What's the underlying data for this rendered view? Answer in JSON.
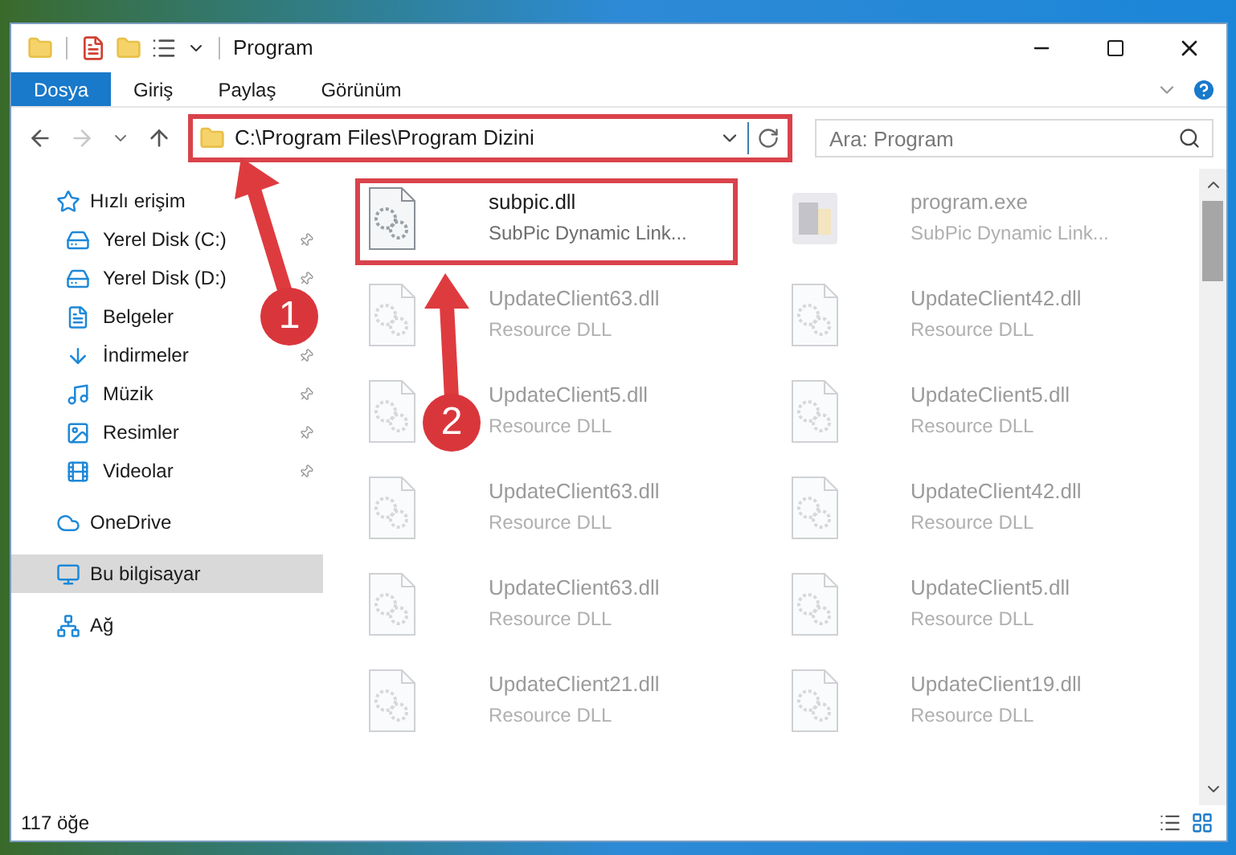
{
  "window": {
    "title": "Program"
  },
  "ribbon": {
    "tabs": [
      {
        "label": "Dosya",
        "kind": "file",
        "selected": false
      },
      {
        "label": "Giriş",
        "kind": "tab",
        "selected": false
      },
      {
        "label": "Paylaş",
        "kind": "tab",
        "selected": false
      },
      {
        "label": "Görünüm",
        "kind": "tab",
        "selected": false
      }
    ]
  },
  "address_bar": {
    "path": "C:\\Program Files\\Program Dizini",
    "highlighted": true
  },
  "search": {
    "placeholder": "Ara: Program"
  },
  "sidebar": {
    "items": [
      {
        "label": "Hızlı erişim",
        "selected": false,
        "children": [
          {
            "label": "Yerel Disk (C:)",
            "pinned": true
          },
          {
            "label": "Yerel Disk (D:)",
            "pinned": true
          },
          {
            "label": "Belgeler",
            "pinned": false
          },
          {
            "label": "İndirmeler",
            "pinned": true
          },
          {
            "label": "Müzik",
            "pinned": true
          },
          {
            "label": "Resimler",
            "pinned": true
          },
          {
            "label": "Videolar",
            "pinned": true
          }
        ]
      },
      {
        "label": "OneDrive",
        "selected": false
      },
      {
        "label": "Bu bilgisayar",
        "selected": true
      },
      {
        "label": "Ağ",
        "selected": false
      }
    ]
  },
  "files": [
    {
      "name": "subpic.dll",
      "type": "SubPic Dynamic Link...",
      "kind": "dll",
      "highlighted": true,
      "dimmed": false
    },
    {
      "name": "program.exe",
      "type": "SubPic Dynamic Link...",
      "kind": "exe",
      "highlighted": false,
      "dimmed": true
    },
    {
      "name": "UpdateClient63.dll",
      "type": "Resource DLL",
      "kind": "dll",
      "highlighted": false,
      "dimmed": true
    },
    {
      "name": "UpdateClient42.dll",
      "type": "Resource DLL",
      "kind": "dll",
      "highlighted": false,
      "dimmed": true
    },
    {
      "name": "UpdateClient5.dll",
      "type": "Resource DLL",
      "kind": "dll",
      "highlighted": false,
      "dimmed": true
    },
    {
      "name": "UpdateClient5.dll",
      "type": "Resource DLL",
      "kind": "dll",
      "highlighted": false,
      "dimmed": true
    },
    {
      "name": "UpdateClient63.dll",
      "type": "Resource DLL",
      "kind": "dll",
      "highlighted": false,
      "dimmed": true
    },
    {
      "name": "UpdateClient42.dll",
      "type": "Resource DLL",
      "kind": "dll",
      "highlighted": false,
      "dimmed": true
    },
    {
      "name": "UpdateClient63.dll",
      "type": "Resource DLL",
      "kind": "dll",
      "highlighted": false,
      "dimmed": true
    },
    {
      "name": "UpdateClient5.dll",
      "type": "Resource DLL",
      "kind": "dll",
      "highlighted": false,
      "dimmed": true
    },
    {
      "name": "UpdateClient21.dll",
      "type": "Resource DLL",
      "kind": "dll",
      "highlighted": false,
      "dimmed": true
    },
    {
      "name": "UpdateClient19.dll",
      "type": "Resource DLL",
      "kind": "dll",
      "highlighted": false,
      "dimmed": true
    }
  ],
  "status_bar": {
    "count": "117 öğe"
  },
  "steps": [
    {
      "number": "1"
    },
    {
      "number": "2"
    }
  ]
}
